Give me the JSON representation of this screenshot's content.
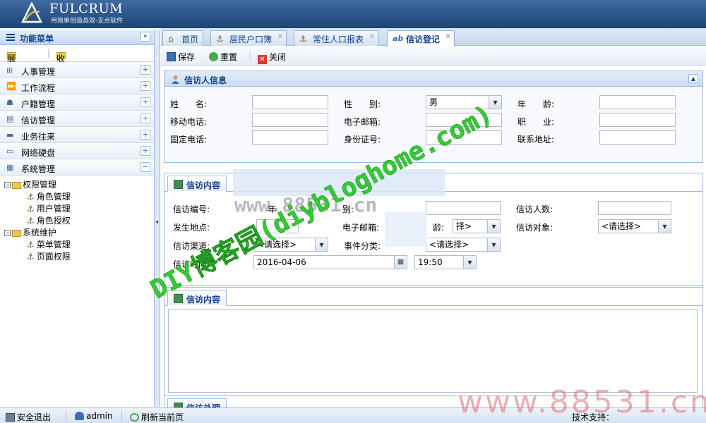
{
  "app": {
    "logo_name": "FULCRUM",
    "logo_sub": "用简单创造高效-支点软件",
    "brand_color": "#1d4575"
  },
  "sidebar": {
    "title": "功能菜单",
    "collapse_glyph": "«",
    "expand_all": "展开",
    "collapse_all": "收起",
    "sections": [
      {
        "label": "人事管理",
        "icon": "org-chart-icon",
        "toggle": "+"
      },
      {
        "label": "工作流程",
        "icon": "workflow-icon",
        "toggle": "+"
      },
      {
        "label": "户籍管理",
        "icon": "household-icon",
        "toggle": "+"
      },
      {
        "label": "信访管理",
        "icon": "petition-icon",
        "toggle": "+"
      },
      {
        "label": "业务往来",
        "icon": "business-icon",
        "toggle": "+"
      },
      {
        "label": "网络硬盘",
        "icon": "drive-icon",
        "toggle": "+"
      },
      {
        "label": "系统管理",
        "icon": "system-icon",
        "toggle": "−"
      }
    ],
    "tree": [
      {
        "label": "权限管理",
        "children": [
          "角色管理",
          "用户管理",
          "角色授权"
        ]
      },
      {
        "label": "系统维护",
        "children": [
          "菜单管理",
          "页面权限"
        ]
      }
    ]
  },
  "tabs": [
    {
      "label": "首页",
      "icon": "home-icon",
      "closable": false
    },
    {
      "label": "居民户口簿",
      "icon": "anchor-icon",
      "closable": true
    },
    {
      "label": "常住人口报表",
      "icon": "anchor-icon",
      "closable": true
    },
    {
      "label": "信访登记",
      "icon": "ab-icon",
      "closable": true,
      "active": true
    }
  ],
  "tab_icon_text": "ab",
  "close_glyph": "×",
  "toolbar": {
    "save": "保存",
    "reset": "重置",
    "close": "关闭"
  },
  "petitioner_panel": {
    "title": "信访人信息",
    "fields": {
      "name_label": "姓　　名:",
      "gender_label": "性　　别:",
      "gender_value": "男",
      "age_label": "年　　龄:",
      "mobile_label": "移动电话:",
      "email_label": "电子邮箱:",
      "job_label": "职　　业:",
      "phone_label": "固定电话:",
      "id_label": "身份证号:",
      "address_label": "联系地址:"
    }
  },
  "petition_panel": {
    "tab_title": "信访内容",
    "fields": {
      "number_label": "信访编号:",
      "count_label": "信访人数:",
      "place_label": "发生地点:",
      "target_label": "信访对象:",
      "target_value": "<请选择>",
      "channel_label": "信访渠道:",
      "channel_value": "<请选择>",
      "category_label": "事件分类:",
      "category_value": "<请选择>",
      "time_label": "信访时间:",
      "date_value": "2016-04-06",
      "time_value": "19:50"
    },
    "partial": {
      "age_fragment": "年",
      "gender_fragment": "别:",
      "email_label": "电子邮箱:",
      "age_frag2": "龄:",
      "age_select_value": "择>"
    }
  },
  "content_panel": {
    "title": "信访内容"
  },
  "process_panel": {
    "title": "信访处理"
  },
  "status": {
    "logout": "安全退出",
    "user": "admin",
    "refresh": "刷新当前页",
    "support": "技术支持："
  },
  "watermarks": {
    "diagonal": "DIY博客园(diybloghome.com)",
    "mid": "www.88531.cn",
    "corner": "www.88531.cn",
    "color": "#33cc33"
  }
}
